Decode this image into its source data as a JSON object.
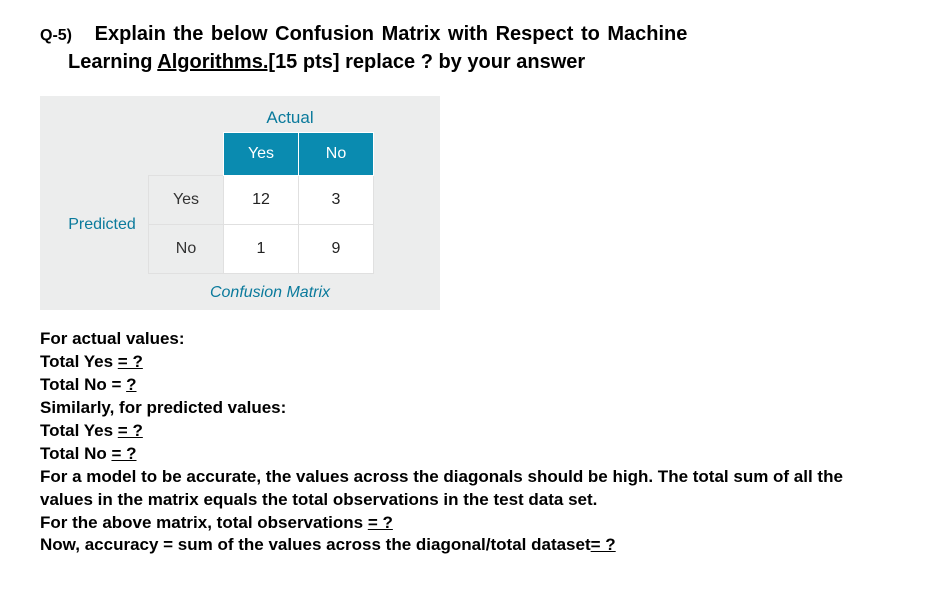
{
  "question": {
    "number": "Q-5)",
    "title_line1": "Explain the below Confusion Matrix with Respect to Machine",
    "title_line2_pre": "Learning ",
    "title_line2_under": "Algorithms.[",
    "title_line2_post": "15 pts] replace ? by your answer"
  },
  "matrix": {
    "top_label": "Actual",
    "side_label": "Predicted",
    "col_yes": "Yes",
    "col_no": "No",
    "row_yes": "Yes",
    "row_no": "No",
    "cell_tp": "12",
    "cell_fp": "3",
    "cell_fn": "1",
    "cell_tn": "9",
    "caption": "Confusion Matrix"
  },
  "body": {
    "l1": "For actual values:",
    "l2_pre": "Total Yes ",
    "l2_eq": "= ?",
    "l3_pre": "Total No = ",
    "l3_q": "?",
    "l4": "Similarly, for predicted values:",
    "l5_pre": "Total Yes ",
    "l5_eq": "= ?",
    "l6_pre": "Total No ",
    "l6_eq": "= ?",
    "l7": "For a model to be accurate, the values across the diagonals should be high. The total sum of all the values in the matrix equals the total observations in the test data set.",
    "l8_pre": "For the above matrix, total observations ",
    "l8_eq": "= ?",
    "l9_pre": "Now, accuracy = sum of the values across the diagonal/total dataset",
    "l9_eq": "= ?"
  }
}
